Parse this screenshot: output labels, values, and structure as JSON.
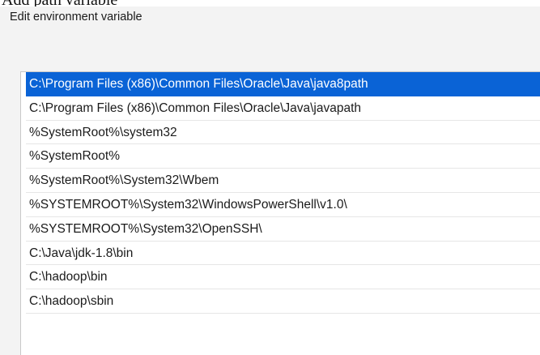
{
  "caption": "Add path variable",
  "dialog": {
    "title": "Edit environment variable"
  },
  "path_list": {
    "selected_index": 0,
    "items": [
      "C:\\Program Files (x86)\\Common Files\\Oracle\\Java\\java8path",
      "C:\\Program Files (x86)\\Common Files\\Oracle\\Java\\javapath",
      "%SystemRoot%\\system32",
      "%SystemRoot%",
      "%SystemRoot%\\System32\\Wbem",
      "%SYSTEMROOT%\\System32\\WindowsPowerShell\\v1.0\\",
      "%SYSTEMROOT%\\System32\\OpenSSH\\",
      "C:\\Java\\jdk-1.8\\bin",
      "C:\\hadoop\\bin",
      "C:\\hadoop\\sbin"
    ]
  },
  "colors": {
    "selection": "#0a63d6",
    "dialog_background": "#f3f3f3"
  }
}
